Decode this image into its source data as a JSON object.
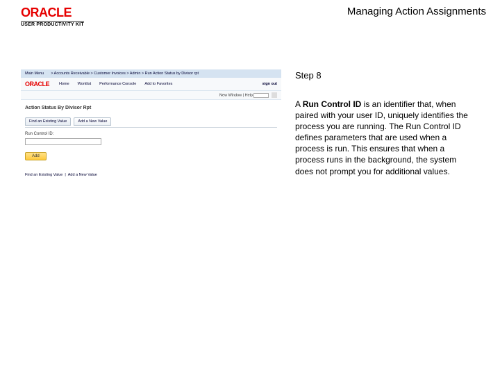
{
  "header": {
    "logo_text": "ORACLE",
    "logo_subtext": "USER PRODUCTIVITY KIT",
    "page_title": "Managing Action Assignments"
  },
  "screenshot": {
    "topbar": {
      "crumb_main": "Main Menu",
      "crumb_path": "> Accounts Receivable > Customer Invoices > Admin > Run Action Status by Divisor rpt",
      "right": [
        "Home",
        "Worklist",
        "Performance Console",
        "Add to Favorites",
        "sign out"
      ]
    },
    "brandrow": {
      "logo": "ORACLE",
      "nav": [
        "Home",
        "Worklist",
        "Performance Console",
        "Add to Favorites"
      ],
      "signout": "sign out"
    },
    "subrow": {
      "label": "New Window | Help"
    },
    "body": {
      "heading": "Action Status By Divisor Rpt",
      "tabs": [
        "Find an Existing Value",
        "Add a New Value"
      ],
      "field_label": "Run Control ID:",
      "add_btn": "Add",
      "footer_left": "Find an Existing Value",
      "footer_right": "Add a New Value"
    }
  },
  "side": {
    "step": "Step 8",
    "desc_pre": "A ",
    "desc_bold": "Run Control ID",
    "desc_post": " is an identifier that, when paired with your user ID, uniquely identifies the process you are running. The Run Control ID defines parameters that are used when a process is run. This ensures that when a process runs in the background, the system does not prompt you for additional values."
  }
}
